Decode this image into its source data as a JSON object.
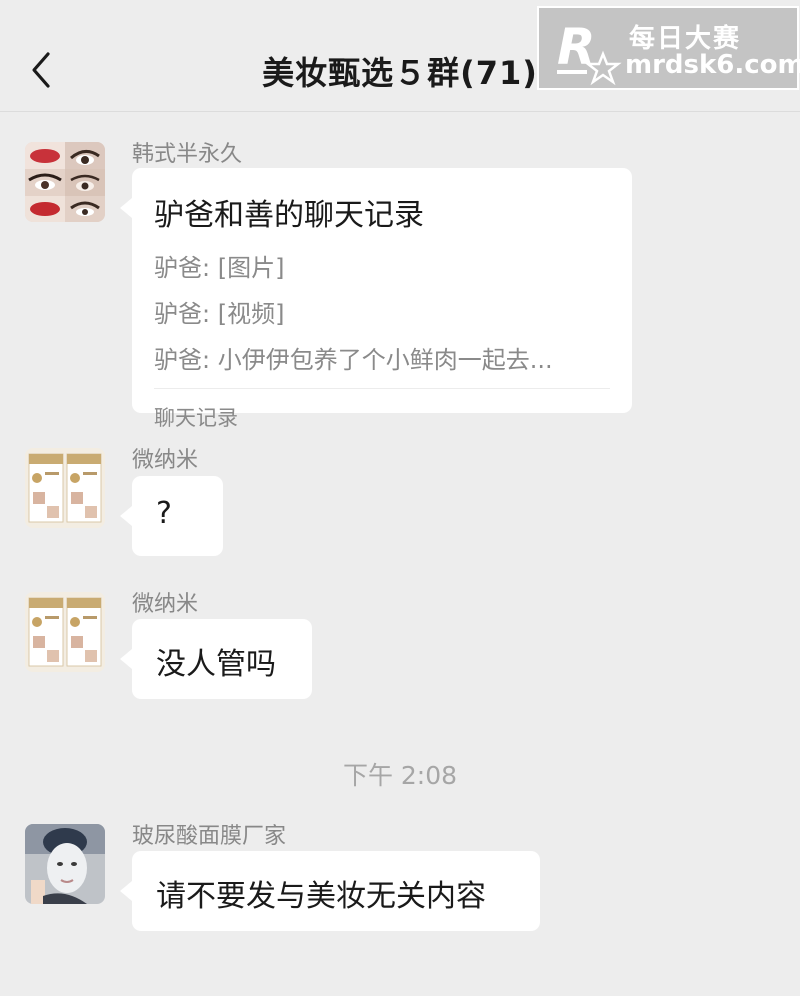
{
  "header": {
    "title": "美妆甄选５群(71)",
    "back_icon": "chevron-left-icon",
    "more_icon": "more-icon"
  },
  "watermark": {
    "line1": "每日大赛",
    "line2": "mrdsk6.com"
  },
  "messages": [
    {
      "sender": "韩式半永久",
      "type": "chat-record",
      "record_title": "驴爸和善的聊天记录",
      "record_lines": [
        "驴爸: [图片]",
        "驴爸: [视频]",
        "驴爸: 小伊伊包养了个小鲜肉一起去..."
      ],
      "record_footer": "聊天记录"
    },
    {
      "sender": "微纳米",
      "type": "text",
      "text": "?"
    },
    {
      "sender": "微纳米",
      "type": "text",
      "text": "没人管吗"
    },
    {
      "sender": "玻尿酸面膜厂家",
      "type": "text",
      "text": "请不要发与美妆无关内容"
    }
  ],
  "timestamp": "下午 2:08"
}
